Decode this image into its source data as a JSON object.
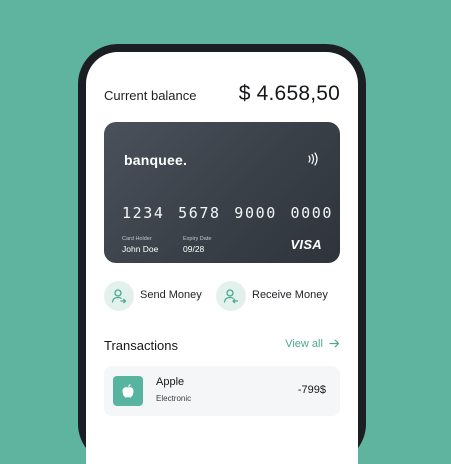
{
  "balance": {
    "label": "Current balance",
    "amount": "$ 4.658,50"
  },
  "card": {
    "brand": "banquee.",
    "number": "1234 5678 9000 0000",
    "holder_caption": "Card Holder",
    "holder_name": "John Doe",
    "expiry_caption": "Expiry Date",
    "expiry": "09/28",
    "network": "VISA",
    "contactless_icon": "contactless-icon"
  },
  "actions": [
    {
      "label": "Send Money",
      "icon": "send-user-icon"
    },
    {
      "label": "Receive Money",
      "icon": "receive-user-icon"
    }
  ],
  "transactions": {
    "title": "Transactions",
    "view_all": "View all",
    "items": [
      {
        "name": "Apple",
        "category": "Electronic",
        "amount": "-799$",
        "icon": "apple-icon"
      }
    ]
  },
  "colors": {
    "background": "#5fb4a0",
    "accent": "#4aaa8f",
    "card": "#3a4048"
  }
}
